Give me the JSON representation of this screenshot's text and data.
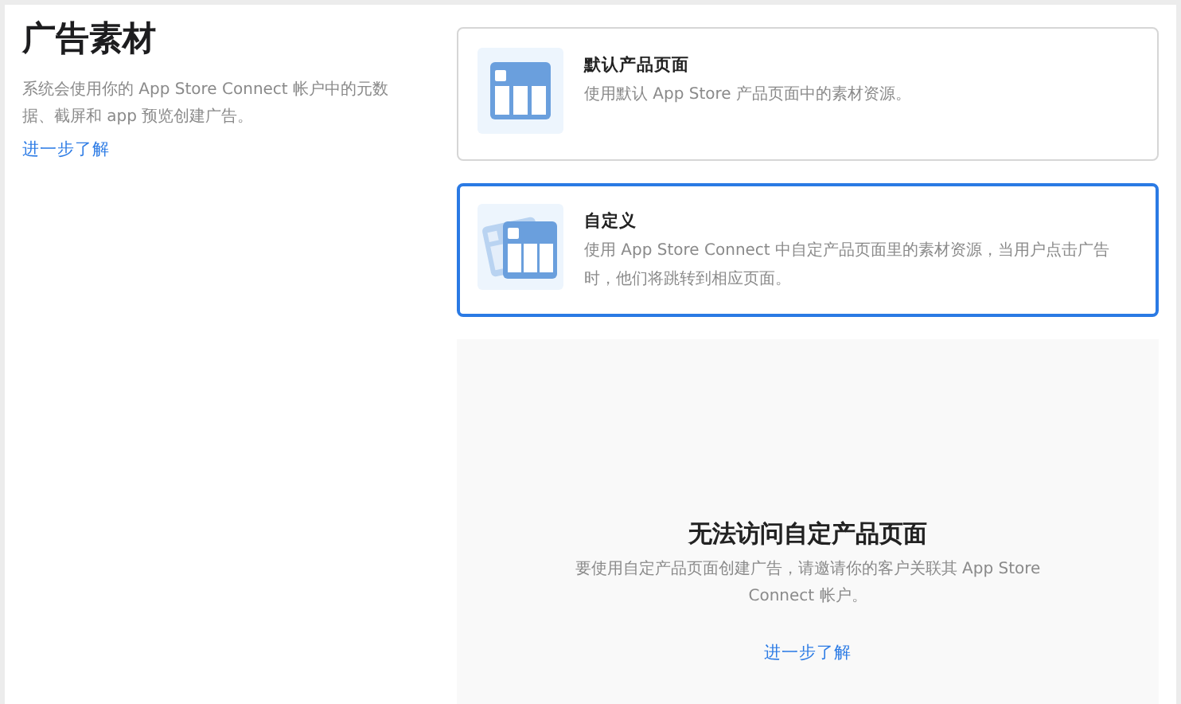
{
  "title": "广告素材",
  "description": "系统会使用你的 App Store Connect 帐户中的元数据、截屏和 app 预览创建广告。",
  "learn_more": "进一步了解",
  "options": [
    {
      "kind": "single",
      "title": "默认产品页面",
      "description": "使用默认 App Store 产品页面中的素材资源。",
      "selected": false
    },
    {
      "kind": "stacked",
      "title": "自定义",
      "description": "使用 App Store Connect 中自定产品页面里的素材资源，当用户点击广告时，他们将跳转到相应页面。",
      "selected": true
    }
  ],
  "empty_state": {
    "title": "无法访问自定产品页面",
    "description": "要使用自定产品页面创建广告，请邀请你的客户关联其 App Store Connect 帐户。",
    "link": "进一步了解"
  }
}
